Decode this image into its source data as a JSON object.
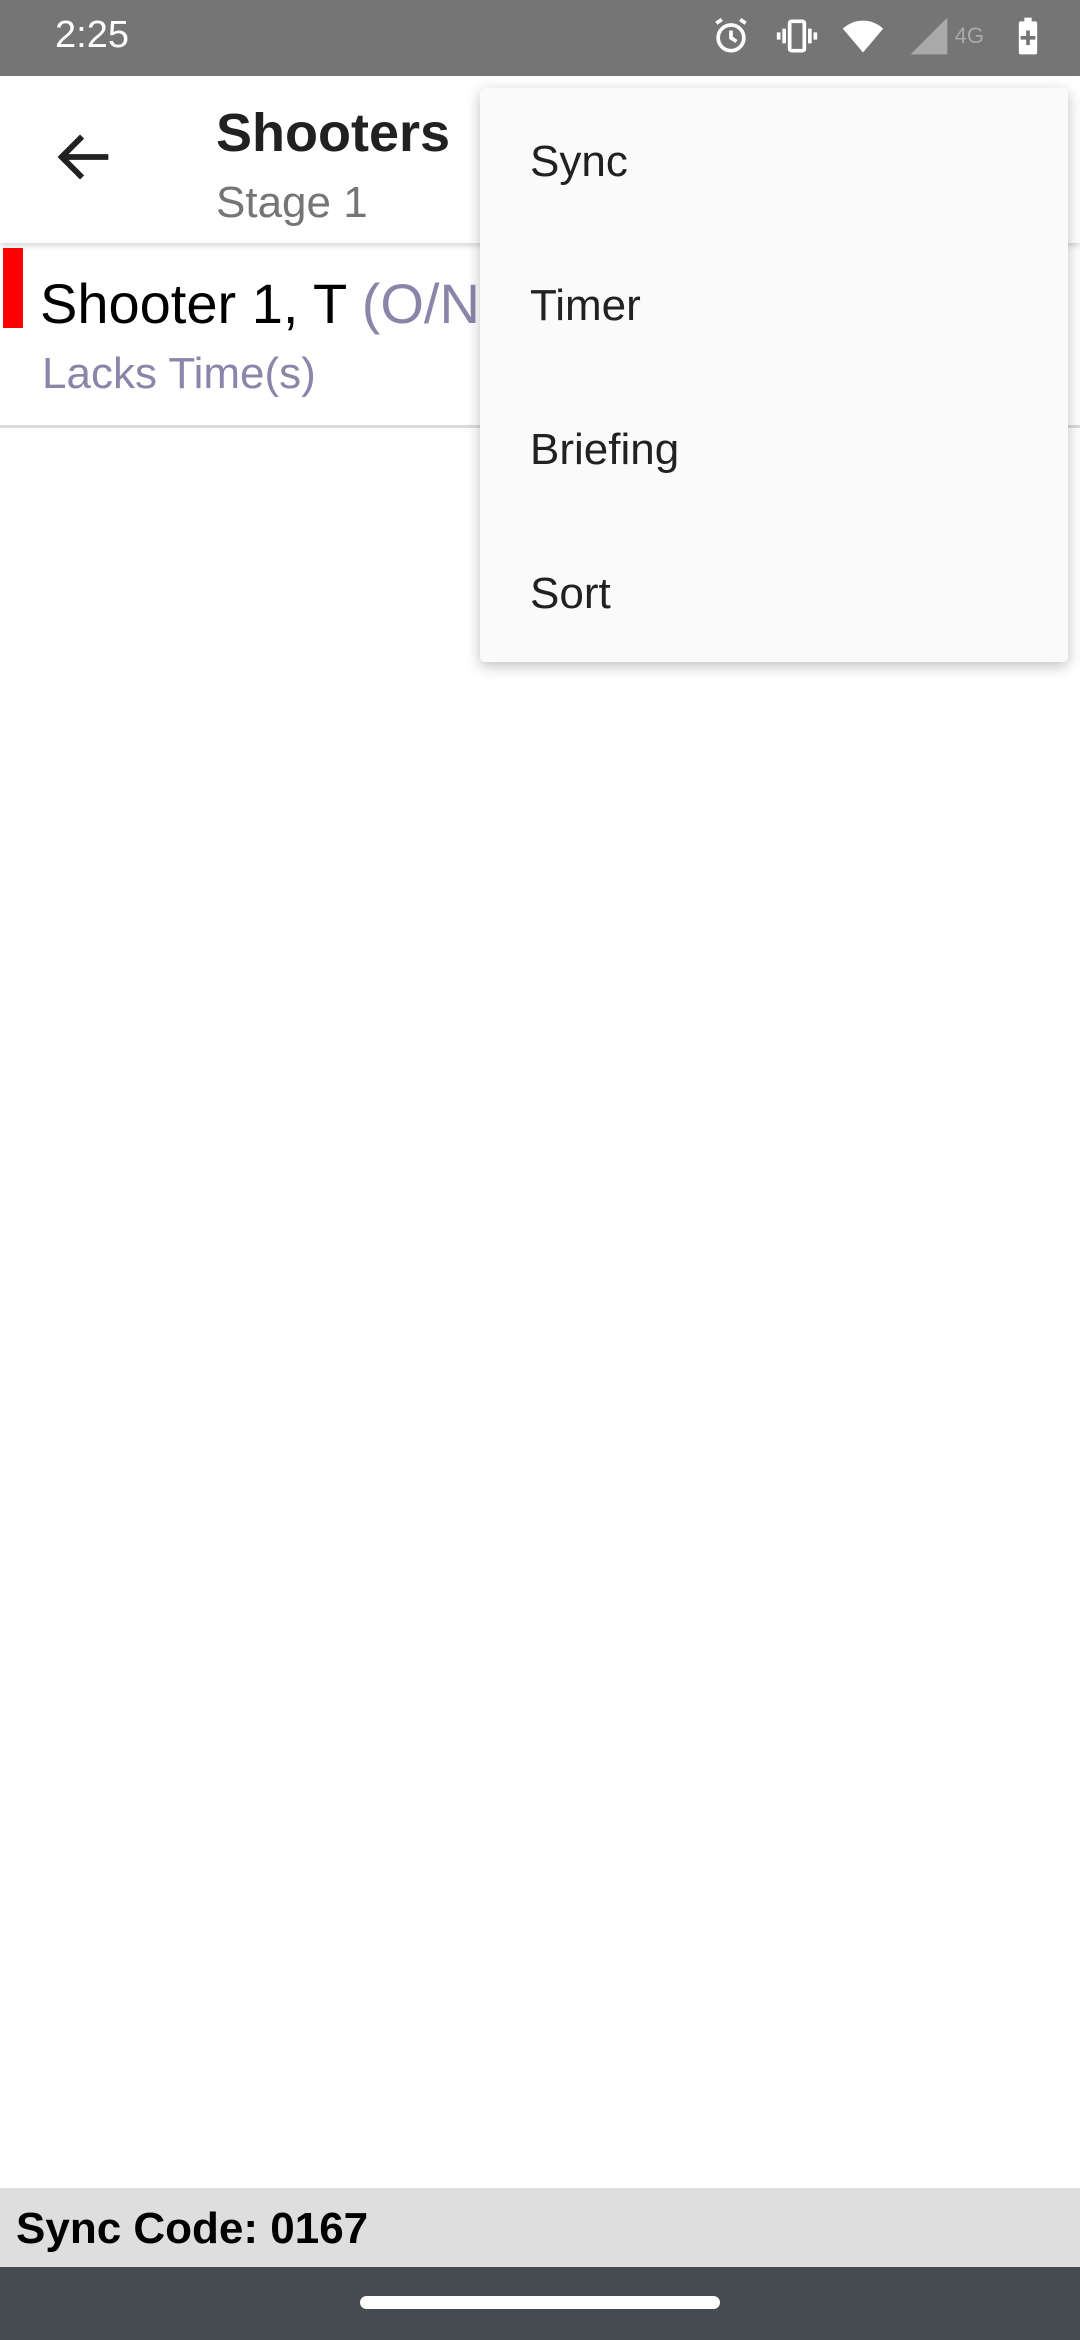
{
  "status_bar": {
    "time": "2:25",
    "network_label": "4G",
    "icons": [
      "alarm-icon",
      "vibrate-icon",
      "wifi-icon",
      "signal-icon",
      "battery-charging-icon"
    ]
  },
  "app_bar": {
    "title": "Shooters",
    "subtitle": "Stage 1",
    "back_icon": "arrow-left-icon"
  },
  "list": {
    "items": [
      {
        "name": "Shooter 1, T",
        "name_suffix": "(O/N",
        "status": "Lacks Time(s)",
        "indicator_color": "#ff0000"
      }
    ]
  },
  "menu": {
    "items": [
      {
        "label": "Sync"
      },
      {
        "label": "Timer"
      },
      {
        "label": "Briefing"
      },
      {
        "label": "Sort"
      }
    ]
  },
  "footer": {
    "sync_code": "Sync Code: 0167"
  },
  "colors": {
    "status_bar": "#757575",
    "footer": "#dedede",
    "nav_bar": "#454c51",
    "secondary_text": "#8a86aa"
  }
}
